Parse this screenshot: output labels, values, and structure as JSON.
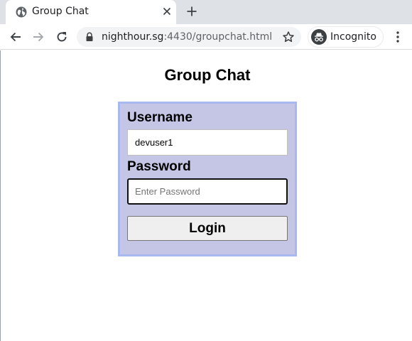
{
  "browser": {
    "tab": {
      "title": "Group Chat",
      "icon": "globe-icon"
    },
    "address_bar": {
      "host": "nighthour.sg",
      "rest": ":4430/groupchat.html"
    },
    "incognito_label": "Incognito"
  },
  "page": {
    "title": "Group Chat",
    "form": {
      "username_label": "Username",
      "username_value": "devuser1",
      "password_label": "Password",
      "password_placeholder": "Enter Password",
      "password_value": "",
      "login_label": "Login"
    }
  },
  "colors": {
    "panel_background": "#c5c6e6",
    "panel_border": "#a8b9f0",
    "tabstrip": "#dee1e6"
  }
}
